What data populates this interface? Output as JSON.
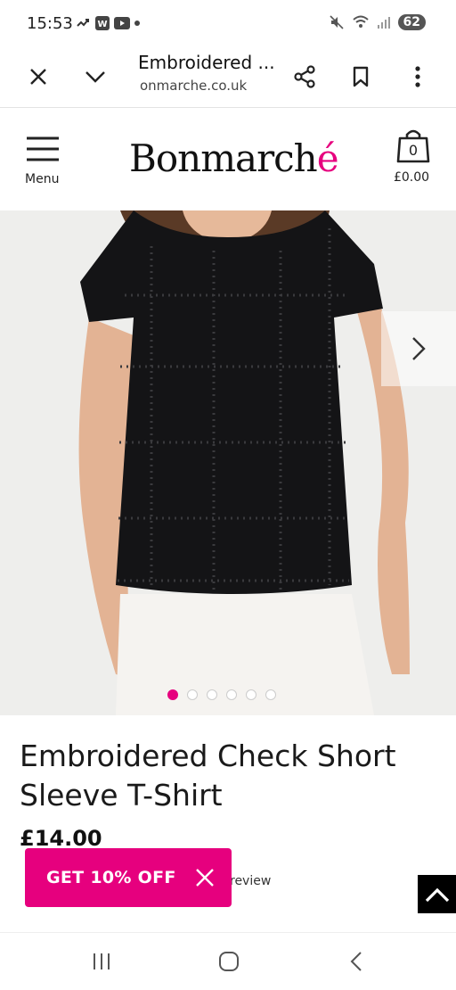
{
  "status_bar": {
    "time": "15:53",
    "battery": "62",
    "left_icons": [
      "missed-call-icon",
      "word-app-icon",
      "youtube-icon",
      "dot-icon"
    ],
    "right_icons": [
      "mute-icon",
      "wifi-icon",
      "signal-icon"
    ]
  },
  "browser": {
    "page_title": "Embroidered ...",
    "url": "onmarche.co.uk",
    "buttons": [
      "close-icon",
      "chevron-down-icon",
      "share-icon",
      "bookmark-icon",
      "more-icon"
    ]
  },
  "header": {
    "menu_label": "Menu",
    "logo_text": "Bonmarché",
    "bag_count": "0",
    "bag_price": "£0.00"
  },
  "gallery": {
    "image_count": 6,
    "active_index": 0,
    "next_icon": "chevron-right-icon"
  },
  "product": {
    "title": "Embroidered Check Short Sleeve T-Shirt",
    "price": "£14.00",
    "review_text": "review"
  },
  "promo": {
    "label": "GET 10% OFF"
  },
  "colors": {
    "accent": "#e6007e",
    "text": "#111111",
    "image_bg": "#eeeeec"
  },
  "nav_bar": {
    "buttons": [
      "recent-apps-icon",
      "home-icon",
      "back-icon"
    ]
  }
}
